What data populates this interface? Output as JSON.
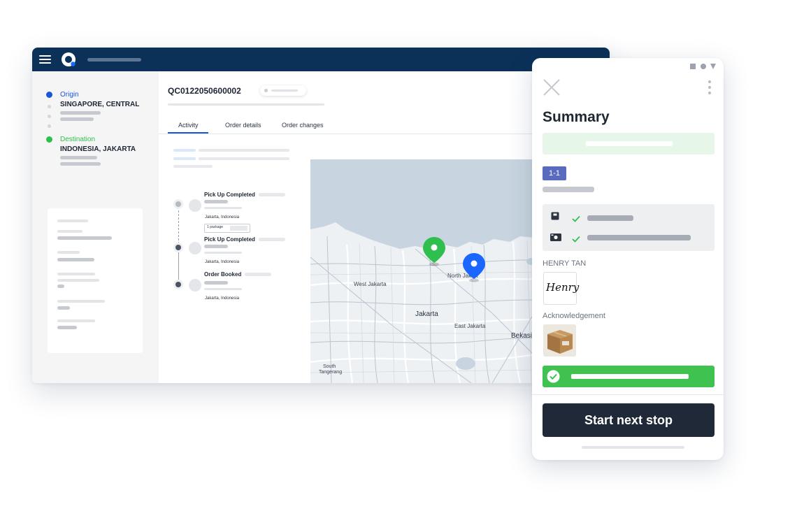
{
  "app": {
    "menu_icon": "hamburger-menu-icon",
    "logo_icon": "logo-icon"
  },
  "order": {
    "id": "QC0122050600002",
    "route": {
      "origin": {
        "label": "Origin",
        "city": "SINGAPORE, CENTRAL",
        "color": "#1a56db"
      },
      "destination": {
        "label": "Destination",
        "city": "INDONESIA, JAKARTA",
        "color": "#2fbf4f"
      }
    },
    "tabs": [
      {
        "label": "Activity",
        "active": true
      },
      {
        "label": "Order details",
        "active": false
      },
      {
        "label": "Order changes",
        "active": false
      }
    ],
    "timeline": [
      {
        "title": "Pick Up Completed",
        "location": "Jakarta, Indonesia",
        "tag": "1 package"
      },
      {
        "title": "Pick Up Completed",
        "location": "Jakarta, Indonesia"
      },
      {
        "title": "Order Booked",
        "location": "Jakarta, Indonesia"
      }
    ]
  },
  "map": {
    "labels": {
      "west_jakarta": "West Jakarta",
      "north_jakarta": "North Jakart",
      "jakarta": "Jakarta",
      "east_jakarta": "East Jakarta",
      "bekasi": "Bekasi",
      "south_tangerang_1": "South",
      "south_tangerang_2": "Tangerang"
    },
    "pins": [
      {
        "name": "origin-pin",
        "color": "#2fbf4f"
      },
      {
        "name": "destination-pin",
        "color": "#1a66ff"
      }
    ]
  },
  "mobile": {
    "status_icons": [
      "square-icon",
      "circle-icon",
      "triangle-icon"
    ],
    "close_icon": "close-icon",
    "more_icon": "more-vertical-icon",
    "title": "Summary",
    "stop_badge": "1-1",
    "checks": [
      {
        "icon": "package-icon",
        "check_icon": "check-icon"
      },
      {
        "icon": "cash-icon",
        "check_icon": "check-icon"
      }
    ],
    "recipient_name": "HENRY TAN",
    "signature_text": "Henry",
    "acknowledgement_label": "Acknowledgement",
    "success_icon": "check-circle-icon",
    "primary_button": "Start next stop",
    "colors": {
      "success": "#3fc24f",
      "success_light": "#e6f6e8",
      "badge": "#5a6bbf",
      "button": "#1f2937"
    }
  }
}
